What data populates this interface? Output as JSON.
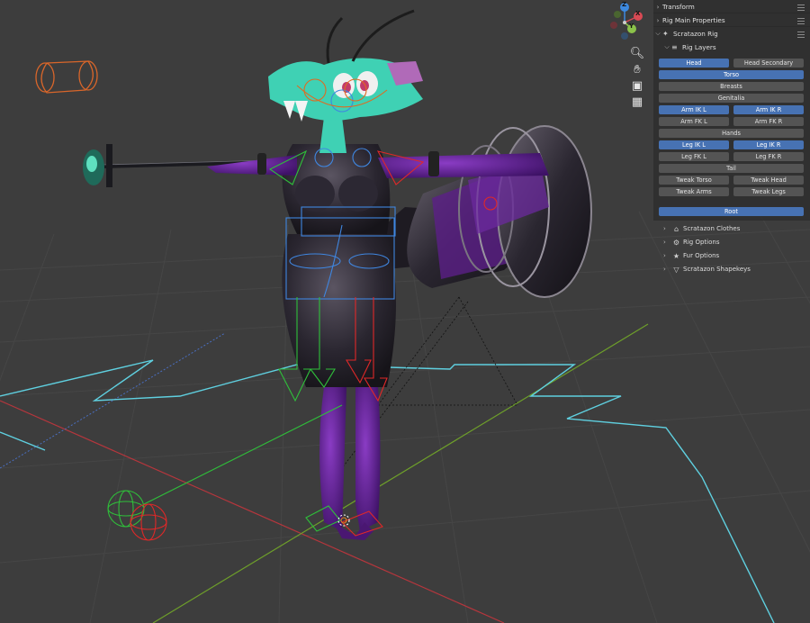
{
  "panel": {
    "sections": [
      {
        "label": "Transform",
        "expanded": false
      },
      {
        "label": "Rig Main Properties",
        "expanded": false
      },
      {
        "label": "Scratazon Rig",
        "expanded": true,
        "icon": "armature-icon"
      }
    ],
    "rig_layers": {
      "label": "Rig Layers",
      "icon": "layers-icon",
      "buttons": {
        "head": {
          "label": "Head",
          "active": true
        },
        "head_secondary": {
          "label": "Head Secondary",
          "active": false
        },
        "torso": {
          "label": "Torso",
          "active": true
        },
        "breasts": {
          "label": "Breasts",
          "active": false
        },
        "genitalia": {
          "label": "Genitalia",
          "active": false
        },
        "arm_ik_l": {
          "label": "Arm IK L",
          "active": true
        },
        "arm_ik_r": {
          "label": "Arm IK R",
          "active": true
        },
        "arm_fk_l": {
          "label": "Arm FK L",
          "active": false
        },
        "arm_fk_r": {
          "label": "Arm FK R",
          "active": false
        },
        "hands": {
          "label": "Hands",
          "active": false
        },
        "leg_ik_l": {
          "label": "Leg IK L",
          "active": true
        },
        "leg_ik_r": {
          "label": "Leg IK R",
          "active": true
        },
        "leg_fk_l": {
          "label": "Leg FK L",
          "active": false
        },
        "leg_fk_r": {
          "label": "Leg FK R",
          "active": false
        },
        "tail": {
          "label": "Tail",
          "active": false
        },
        "tweak_torso": {
          "label": "Tweak Torso",
          "active": false
        },
        "tweak_head": {
          "label": "Tweak Head",
          "active": false
        },
        "tweak_arms": {
          "label": "Tweak Arms",
          "active": false
        },
        "tweak_legs": {
          "label": "Tweak Legs",
          "active": false
        },
        "root": {
          "label": "Root",
          "active": true
        }
      }
    },
    "subpanels": [
      {
        "label": "Scratazon Clothes",
        "icon": "shirt-icon"
      },
      {
        "label": "Rig Options",
        "icon": "gear-icon"
      },
      {
        "label": "Fur Options",
        "icon": "figure-icon"
      },
      {
        "label": "Scratazon Shapekeys",
        "icon": "shapekey-icon"
      }
    ]
  },
  "gizmo": {
    "axes": {
      "x": "X",
      "y": "Y",
      "z": "Z"
    },
    "colors": {
      "x": "#d94a54",
      "y": "#8bc24a",
      "z": "#3d8ae0"
    }
  },
  "nav_buttons": [
    {
      "icon": "zoom-icon"
    },
    {
      "icon": "hand-pan-icon"
    },
    {
      "icon": "camera-icon"
    },
    {
      "icon": "grid-view-icon"
    }
  ],
  "colors": {
    "viewport_bg": "#3d3d3d",
    "panel_bg": "#303030",
    "button_active": "#4772b3",
    "button_inactive": "#545454",
    "axis_x": "#b5363d",
    "axis_y": "#6e9f2a",
    "char_skin": "#3fd1b4",
    "char_suit": "#5b1f87"
  }
}
